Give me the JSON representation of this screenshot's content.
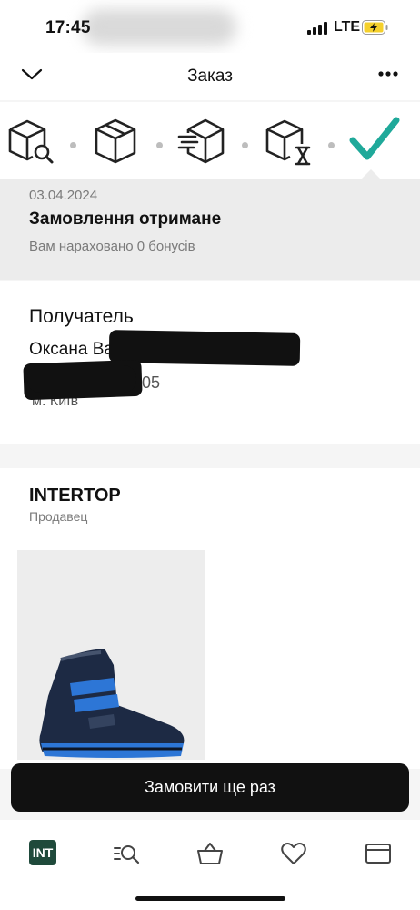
{
  "status_bar": {
    "time": "17:45",
    "network": "LTE"
  },
  "header": {
    "title": "Заказ"
  },
  "steps": [
    "search-box-icon",
    "box-icon",
    "fast-delivery-box-icon",
    "box-hourglass-icon",
    "check-icon"
  ],
  "order": {
    "date": "03.04.2024",
    "status": "Замовлення отримане",
    "bonus": "Вам нараховано 0 бонусів"
  },
  "recipient": {
    "label": "Получатель",
    "name": "Оксана Вал",
    "phone": "2 00 05",
    "city": "м. Київ"
  },
  "seller": {
    "name": "INTERTOP",
    "label": "Продавец"
  },
  "cta": {
    "label": "Замовити ще раз"
  },
  "tabbar": {
    "items": [
      "intertop-logo-icon",
      "search-list-icon",
      "basket-icon",
      "heart-icon",
      "orders-icon"
    ],
    "logo_text": "INT"
  },
  "colors": {
    "accent": "#1fa99a",
    "cta_bg": "#111111"
  }
}
